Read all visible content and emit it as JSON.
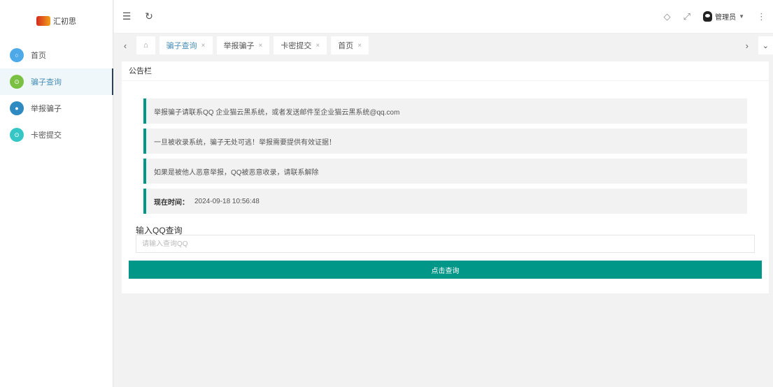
{
  "logo": {
    "text": "汇初思"
  },
  "sidebar": {
    "items": [
      {
        "label": "首页",
        "color": "#4ea9e8"
      },
      {
        "label": "骗子查询",
        "color": "#7ac143"
      },
      {
        "label": "举报骗子",
        "color": "#2f8ac1"
      },
      {
        "label": "卡密提交",
        "color": "#36c6c6"
      }
    ]
  },
  "header": {
    "user": "管理员"
  },
  "tabs": [
    {
      "label": "骗子查询"
    },
    {
      "label": "举报骗子"
    },
    {
      "label": "卡密提交"
    },
    {
      "label": "首页"
    }
  ],
  "card": {
    "title": "公告栏",
    "notices": [
      "举报骗子请联系QQ 企业猫云黑系统，或者发送邮件至企业猫云黑系统@qq.com",
      "一旦被收录系统，骗子无处可逃！举报需要提供有效证据！",
      "如果是被他人恶意举报，QQ被恶意收录，请联系解除"
    ],
    "time_label": "现在时间：",
    "time_value": "2024-09-18 10:56:48",
    "query_label": "输入QQ查询",
    "query_placeholder": "请输入查询QQ",
    "query_button": "点击查询"
  }
}
